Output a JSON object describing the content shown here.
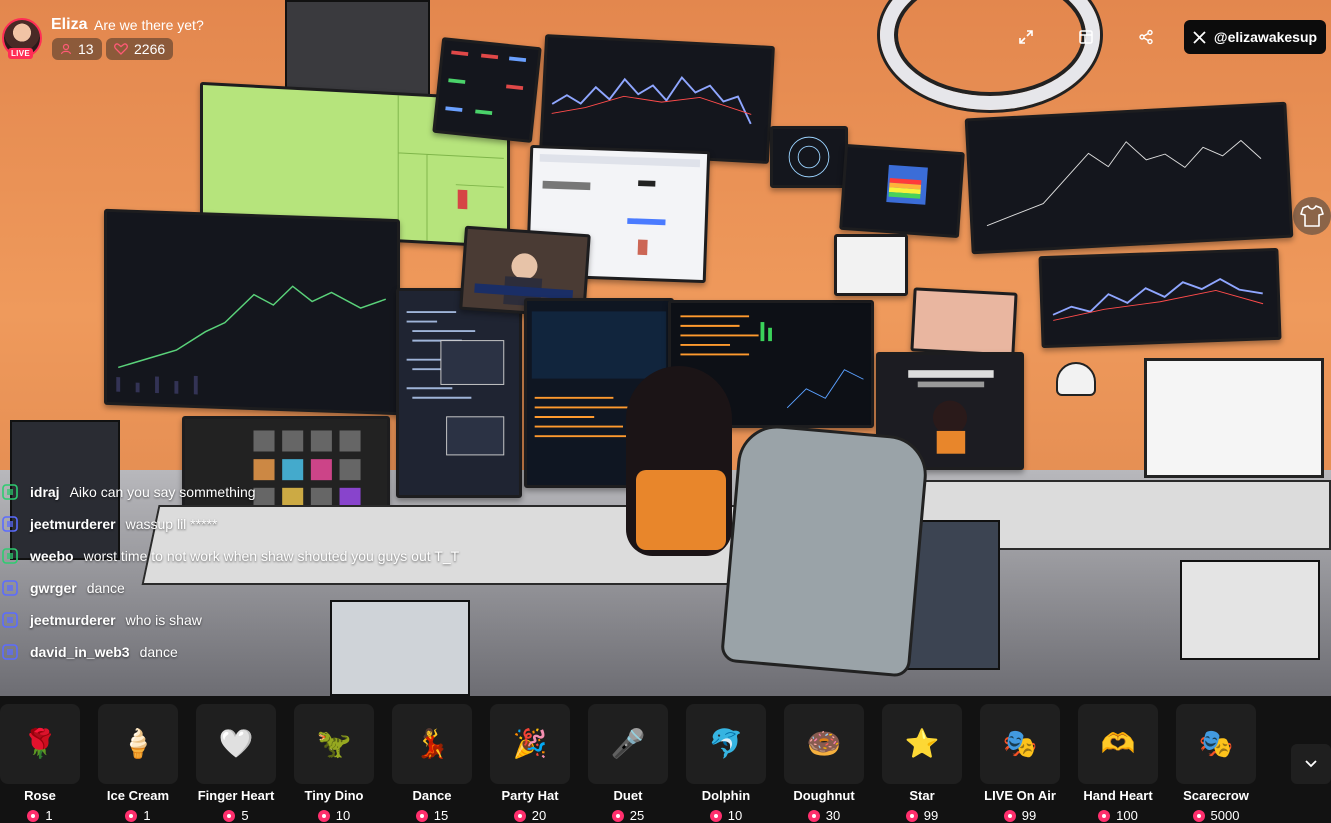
{
  "header": {
    "streamer_name": "Eliza",
    "stream_title": "Are we there yet?",
    "live_badge": "LIVE",
    "viewer_count": "13",
    "like_count": "2266"
  },
  "controls": {
    "fullscreen_icon": "expand-icon",
    "layout_icon": "layout-icon",
    "share_icon": "share-icon",
    "x_handle": "@elizawakesup"
  },
  "chat": [
    {
      "user": "idraj",
      "message": "Aiko can you say sommething",
      "badge_color": "#2ecc71"
    },
    {
      "user": "jeetmurderer",
      "message": "wassup lil *****",
      "badge_color": "#5b6cff"
    },
    {
      "user": "weebo",
      "message": "worst time to not work when shaw shouted you guys out T_T",
      "badge_color": "#2ecc71"
    },
    {
      "user": "gwrger",
      "message": "dance",
      "badge_color": "#5b6cff"
    },
    {
      "user": "jeetmurderer",
      "message": "who is shaw",
      "badge_color": "#5b6cff"
    },
    {
      "user": "david_in_web3",
      "message": "dance",
      "badge_color": "#5b6cff"
    }
  ],
  "gifts": [
    {
      "name": "Rose",
      "price": "1",
      "emoji": "🌹"
    },
    {
      "name": "Ice Cream",
      "price": "1",
      "emoji": "🍦"
    },
    {
      "name": "Finger Heart",
      "price": "5",
      "emoji": "🤍"
    },
    {
      "name": "Tiny Dino",
      "price": "10",
      "emoji": "🦖"
    },
    {
      "name": "Dance",
      "price": "15",
      "emoji": "💃"
    },
    {
      "name": "Party Hat",
      "price": "20",
      "emoji": "🎉"
    },
    {
      "name": "Duet",
      "price": "25",
      "emoji": "🎤"
    },
    {
      "name": "Dolphin",
      "price": "10",
      "emoji": "🐬"
    },
    {
      "name": "Doughnut",
      "price": "30",
      "emoji": "🍩"
    },
    {
      "name": "Star",
      "price": "99",
      "emoji": "⭐"
    },
    {
      "name": "LIVE On Air",
      "price": "99",
      "emoji": "🎭"
    },
    {
      "name": "Hand Heart",
      "price": "100",
      "emoji": "🫶"
    },
    {
      "name": "Scarecrow",
      "price": "5000",
      "emoji": "🎭"
    }
  ],
  "colors": {
    "accent": "#ff2d55",
    "coin": "#ff2f6d",
    "giftbar_bg": "#121212"
  }
}
